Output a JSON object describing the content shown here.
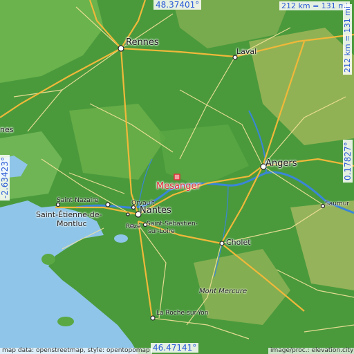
{
  "map": {
    "colors": {
      "sea": "#8ec5e8",
      "land_green": "#4a9a3c",
      "land_light": "#7cc05a",
      "hills": "#b9c06a",
      "road_major": "#f0b83a",
      "road_minor": "#f4e29a",
      "river": "#3a86d8",
      "marker": "#e0303a",
      "coord_text": "#2b5bd7"
    },
    "coordinates": {
      "top_lat": "48.37401°",
      "bottom_lat": "46.47141°",
      "left_lon": "-2.63423°",
      "right_lon": "0.17827°"
    },
    "scale": {
      "horizontal": "212 km = 131 mi",
      "vertical": "212 km = 131 mi"
    },
    "marker": {
      "name": "Mesanger",
      "icon": "square-marker-icon"
    },
    "places": {
      "rennes": "Rennes",
      "laval": "Laval",
      "angers": "Angers",
      "nantes": "Nantes",
      "saint_nazaire": "Saint-Nazaire",
      "saint_etienne_1": "Saint-Étienne-de-",
      "saint_etienne_2": "Montluc",
      "orvault": "Orvault",
      "reze": "Rezé",
      "saint_sebastien_1": "Saint-Sébastien-",
      "saint_sebastien_2": "sur-Loire",
      "cholet": "Cholet",
      "saumur": "Saumur",
      "mont_mercure": "Mont Mercure",
      "la_roche": "La Roche-sur-Yon",
      "vannes_partial": "nes"
    },
    "credits": {
      "left": "map data: openstreetmap, style: opentopomap",
      "right": "image/proc.: elevation.city"
    }
  }
}
